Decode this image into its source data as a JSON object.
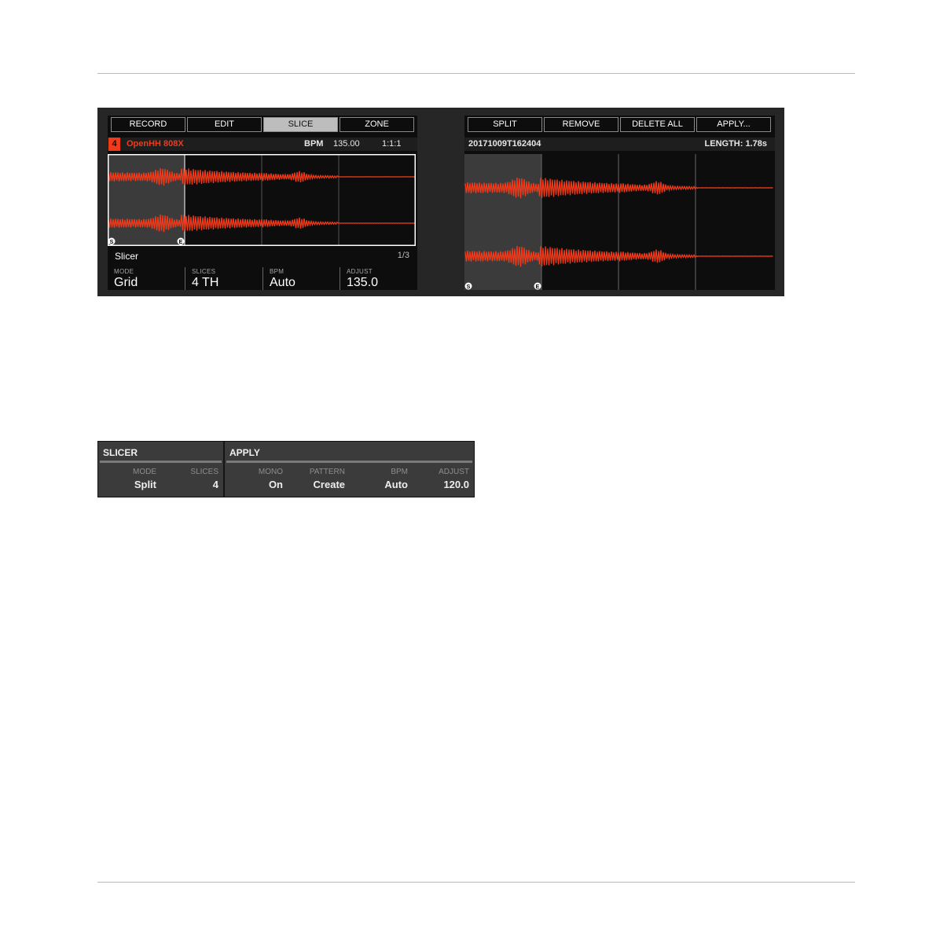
{
  "left_screen": {
    "top_buttons": [
      "RECORD",
      "EDIT",
      "SLICE",
      "ZONE"
    ],
    "active_button": "SLICE",
    "slot_number": "4",
    "sound_name": "OpenHH 808X",
    "bpm_label": "BPM",
    "bpm_value": "135.00",
    "position": "1:1:1",
    "marker_start": "S",
    "marker_end": "E",
    "section_label": "Slicer",
    "page": "1/3",
    "params": [
      {
        "label": "MODE",
        "value": "Grid"
      },
      {
        "label": "SLICES",
        "value": "4 TH"
      },
      {
        "label": "BPM",
        "value": "Auto"
      },
      {
        "label": "ADJUST",
        "value": "135.0"
      }
    ]
  },
  "right_screen": {
    "top_buttons": [
      "SPLIT",
      "REMOVE",
      "DELETE ALL",
      "APPLY..."
    ],
    "sample_name": "20171009T162404",
    "length": "LENGTH: 1.78s",
    "marker_start": "S",
    "marker_end": "E"
  },
  "software_strip": {
    "slicer": {
      "title": "SLICER",
      "params": [
        {
          "label": "MODE",
          "value": "Split"
        },
        {
          "label": "SLICES",
          "value": "4"
        }
      ]
    },
    "apply": {
      "title": "APPLY",
      "params": [
        {
          "label": "MONO",
          "value": "On"
        },
        {
          "label": "PATTERN",
          "value": "Create"
        },
        {
          "label": "BPM",
          "value": "Auto"
        },
        {
          "label": "ADJUST",
          "value": "120.0"
        }
      ]
    }
  },
  "colors": {
    "accent": "#f03a1a",
    "screen_bg": "#0d0d0d",
    "frame_bg": "#262626",
    "strip_bg": "#3b3b3b"
  }
}
